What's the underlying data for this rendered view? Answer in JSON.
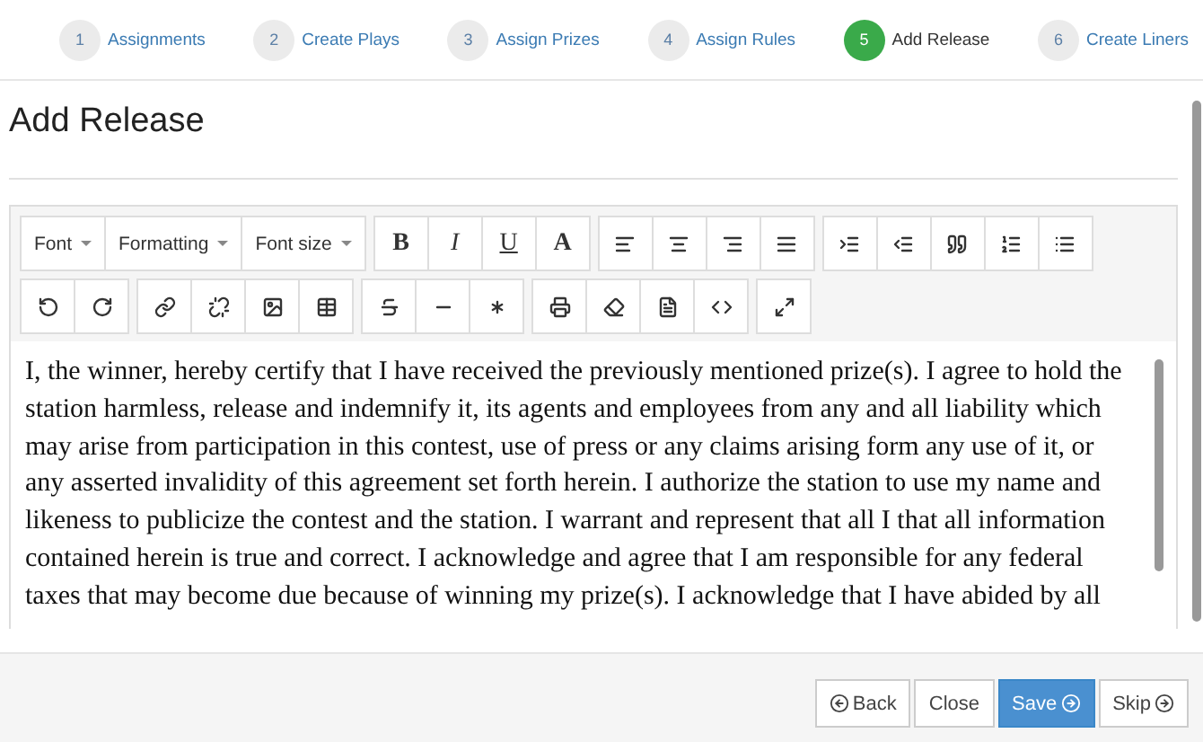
{
  "steps": [
    {
      "number": "1",
      "label": "Assignments",
      "selected": false
    },
    {
      "number": "2",
      "label": "Create Plays",
      "selected": false
    },
    {
      "number": "3",
      "label": "Assign Prizes",
      "selected": false
    },
    {
      "number": "4",
      "label": "Assign Rules",
      "selected": false
    },
    {
      "number": "5",
      "label": "Add Release",
      "selected": true
    },
    {
      "number": "6",
      "label": "Create Liners",
      "selected": false
    }
  ],
  "title": "Add Release",
  "toolbar": {
    "dropdowns": [
      "Font",
      "Formatting",
      "Font size"
    ],
    "styles": [
      "B",
      "I",
      "U",
      "A"
    ]
  },
  "editor": {
    "text": "I, the winner, hereby certify that I have received the previously mentioned prize(s).  I agree to hold the station harmless, release and indemnify it, its agents and employees from any and all liability which may arise from participation in this contest, use of press or any claims arising form any use of it, or any asserted invalidity of this agreement set forth herein.  I authorize the station to use my name and likeness to publicize the contest and the station.  I warrant and represent that all I that all information contained herein is true and correct.  I acknowledge and agree that I am responsible for any federal taxes that may become due because of winning my prize(s).  I acknowledge that I have abided by all"
  },
  "buttons": [
    {
      "label": "Back",
      "primary": false,
      "arrow_before": true,
      "arrow_after": false
    },
    {
      "label": "Close",
      "primary": false,
      "arrow_before": false,
      "arrow_after": false
    },
    {
      "label": "Save",
      "primary": true,
      "arrow_before": false,
      "arrow_after": true
    },
    {
      "label": "Skip",
      "primary": false,
      "arrow_before": false,
      "arrow_after": true
    }
  ]
}
